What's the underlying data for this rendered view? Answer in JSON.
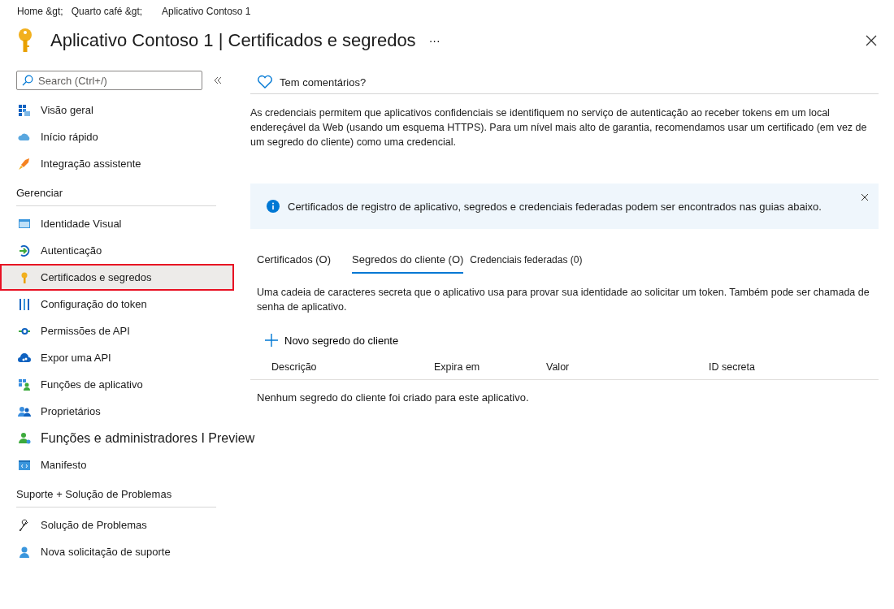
{
  "breadcrumb": [
    "Home &gt;",
    "Quarto café &gt;",
    "Aplicativo Contoso 1"
  ],
  "page_title": "Aplicativo Contoso 1 | Certificados e segredos",
  "more_button": "···",
  "sidebar": {
    "search": {
      "placeholder": "Search (Ctrl+/)"
    },
    "sections": [
      {
        "items": [
          {
            "label": "Visão geral",
            "kind": "item",
            "selected": false
          },
          {
            "label": "Início rápido",
            "kind": "item",
            "selected": false
          },
          {
            "label": "Integração assistente",
            "kind": "item",
            "selected": false
          }
        ]
      },
      {
        "heading": "Gerenciar",
        "items": [
          {
            "label": "Identidade Visual",
            "kind": "item",
            "selected": false
          },
          {
            "label": "Autenticação",
            "kind": "item",
            "selected": false
          },
          {
            "label": "Certificados e segredos",
            "kind": "item",
            "selected": true
          },
          {
            "label": "Configuração do token",
            "kind": "item",
            "selected": false
          },
          {
            "label": "Permissões de API",
            "kind": "item",
            "selected": false
          },
          {
            "label": "Expor uma API",
            "kind": "item",
            "selected": false
          },
          {
            "label": "Funções de aplicativo",
            "kind": "item",
            "selected": false
          },
          {
            "label": "Proprietários",
            "kind": "item",
            "selected": false
          },
          {
            "label": "Funções e administradores I Preview",
            "kind": "large",
            "selected": false
          },
          {
            "label": "Manifesto",
            "kind": "item",
            "selected": false
          }
        ]
      },
      {
        "heading": "Suporte + Solução de Problemas",
        "items": [
          {
            "label": "Solução de Problemas",
            "kind": "item",
            "selected": false
          },
          {
            "label": "Nova solicitação de suporte",
            "kind": "item",
            "selected": false
          }
        ]
      }
    ]
  },
  "feedback": "Tem comentários?",
  "intro": "As credenciais permitem que aplicativos confidenciais se identifiquem no serviço de autenticação ao receber tokens em um local endereçável da Web (usando um esquema HTTPS). Para um nível mais alto de garantia, recomendamos usar um certificado (em vez de um segredo do cliente) como uma credencial.",
  "info_banner": "Certificados de registro de aplicativo, segredos e credenciais federadas podem ser encontrados nas guias abaixo.",
  "tabs": [
    {
      "label": "Certificados (O)",
      "selected": false
    },
    {
      "label": "Segredos do cliente (O)",
      "selected": true
    },
    {
      "label": "Credenciais federadas (0)",
      "selected": false
    }
  ],
  "tab_description": "Uma cadeia de caracteres secreta que o aplicativo usa para provar sua identidade ao solicitar um token. Também pode ser chamada de senha de aplicativo.",
  "new_button": "Novo segredo do cliente",
  "table": {
    "columns": [
      "Descrição",
      "Expira em",
      "Valor",
      "ID secreta"
    ],
    "empty_message": "Nenhum segredo do cliente foi criado para este aplicativo."
  }
}
